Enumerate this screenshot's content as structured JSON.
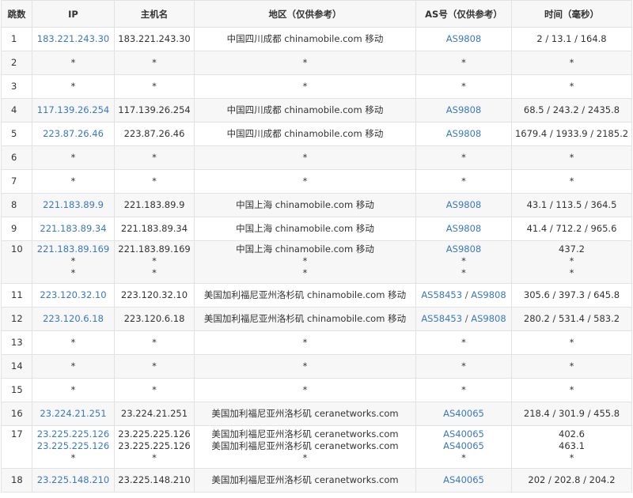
{
  "headers": {
    "hop": "跳数",
    "ip": "IP",
    "host": "主机名",
    "region": "地区（仅供参考）",
    "as": "AS号（仅供参考）",
    "time": "时间（毫秒）"
  },
  "hops": [
    {
      "hop": "1",
      "ips": [
        "183.221.243.30"
      ],
      "hosts": [
        "183.221.243.30"
      ],
      "regions": [
        "中国四川成都 chinamobile.com 移动"
      ],
      "as": [
        [
          "AS9808"
        ]
      ],
      "times": [
        "2 / 13.1 / 164.8"
      ]
    },
    {
      "hop": "2",
      "ips": [
        "*"
      ],
      "hosts": [
        "*"
      ],
      "regions": [
        "*"
      ],
      "as": [
        [
          "*"
        ]
      ],
      "times": [
        "*"
      ]
    },
    {
      "hop": "3",
      "ips": [
        "*"
      ],
      "hosts": [
        "*"
      ],
      "regions": [
        "*"
      ],
      "as": [
        [
          "*"
        ]
      ],
      "times": [
        "*"
      ]
    },
    {
      "hop": "4",
      "ips": [
        "117.139.26.254"
      ],
      "hosts": [
        "117.139.26.254"
      ],
      "regions": [
        "中国四川成都 chinamobile.com 移动"
      ],
      "as": [
        [
          "AS9808"
        ]
      ],
      "times": [
        "68.5 / 243.2 / 2435.8"
      ]
    },
    {
      "hop": "5",
      "ips": [
        "223.87.26.46"
      ],
      "hosts": [
        "223.87.26.46"
      ],
      "regions": [
        "中国四川成都 chinamobile.com 移动"
      ],
      "as": [
        [
          "AS9808"
        ]
      ],
      "times": [
        "1679.4 / 1933.9 / 2185.2"
      ]
    },
    {
      "hop": "6",
      "ips": [
        "*"
      ],
      "hosts": [
        "*"
      ],
      "regions": [
        "*"
      ],
      "as": [
        [
          "*"
        ]
      ],
      "times": [
        "*"
      ]
    },
    {
      "hop": "7",
      "ips": [
        "*"
      ],
      "hosts": [
        "*"
      ],
      "regions": [
        "*"
      ],
      "as": [
        [
          "*"
        ]
      ],
      "times": [
        "*"
      ]
    },
    {
      "hop": "8",
      "ips": [
        "221.183.89.9"
      ],
      "hosts": [
        "221.183.89.9"
      ],
      "regions": [
        "中国上海 chinamobile.com 移动"
      ],
      "as": [
        [
          "AS9808"
        ]
      ],
      "times": [
        "43.1 / 113.5 / 364.5"
      ]
    },
    {
      "hop": "9",
      "ips": [
        "221.183.89.34"
      ],
      "hosts": [
        "221.183.89.34"
      ],
      "regions": [
        "中国上海 chinamobile.com 移动"
      ],
      "as": [
        [
          "AS9808"
        ]
      ],
      "times": [
        "41.4 / 712.2 / 965.6"
      ]
    },
    {
      "hop": "10",
      "ips": [
        "221.183.89.169",
        "*",
        "*"
      ],
      "hosts": [
        "221.183.89.169",
        "*",
        "*"
      ],
      "regions": [
        "中国上海 chinamobile.com 移动",
        "*",
        "*"
      ],
      "as": [
        [
          "AS9808"
        ],
        [
          "*"
        ],
        [
          "*"
        ]
      ],
      "times": [
        "437.2",
        "*",
        "*"
      ]
    },
    {
      "hop": "11",
      "ips": [
        "223.120.32.10"
      ],
      "hosts": [
        "223.120.32.10"
      ],
      "regions": [
        "美国加利福尼亚州洛杉矶 chinamobile.com 移动"
      ],
      "as": [
        [
          "AS58453",
          "AS9808"
        ]
      ],
      "times": [
        "305.6 / 397.3 / 645.8"
      ]
    },
    {
      "hop": "12",
      "ips": [
        "223.120.6.18"
      ],
      "hosts": [
        "223.120.6.18"
      ],
      "regions": [
        "美国加利福尼亚州洛杉矶 chinamobile.com 移动"
      ],
      "as": [
        [
          "AS58453",
          "AS9808"
        ]
      ],
      "times": [
        "280.2 / 531.4 / 583.2"
      ]
    },
    {
      "hop": "13",
      "ips": [
        "*"
      ],
      "hosts": [
        "*"
      ],
      "regions": [
        "*"
      ],
      "as": [
        [
          "*"
        ]
      ],
      "times": [
        "*"
      ]
    },
    {
      "hop": "14",
      "ips": [
        "*"
      ],
      "hosts": [
        "*"
      ],
      "regions": [
        "*"
      ],
      "as": [
        [
          "*"
        ]
      ],
      "times": [
        "*"
      ]
    },
    {
      "hop": "15",
      "ips": [
        "*"
      ],
      "hosts": [
        "*"
      ],
      "regions": [
        "*"
      ],
      "as": [
        [
          "*"
        ]
      ],
      "times": [
        "*"
      ]
    },
    {
      "hop": "16",
      "ips": [
        "23.224.21.251"
      ],
      "hosts": [
        "23.224.21.251"
      ],
      "regions": [
        "美国加利福尼亚州洛杉矶 ceranetworks.com"
      ],
      "as": [
        [
          "AS40065"
        ]
      ],
      "times": [
        "218.4 / 301.9 / 455.8"
      ]
    },
    {
      "hop": "17",
      "ips": [
        "23.225.225.126",
        "23.225.225.126",
        "*"
      ],
      "hosts": [
        "23.225.225.126",
        "23.225.225.126",
        "*"
      ],
      "regions": [
        "美国加利福尼亚州洛杉矶 ceranetworks.com",
        "美国加利福尼亚州洛杉矶 ceranetworks.com",
        "*"
      ],
      "as": [
        [
          "AS40065"
        ],
        [
          "AS40065"
        ],
        [
          "*"
        ]
      ],
      "times": [
        "402.6",
        "463.1",
        "*"
      ]
    },
    {
      "hop": "18",
      "ips": [
        "23.225.148.210"
      ],
      "hosts": [
        "23.225.148.210"
      ],
      "regions": [
        "美国加利福尼亚州洛杉矶 ceranetworks.com"
      ],
      "as": [
        [
          "AS40065"
        ]
      ],
      "times": [
        "202 / 202.8 / 204.2"
      ]
    }
  ],
  "colors": {
    "link": "#3a78c0",
    "header_bg": "#f7f7f7",
    "row_alt_bg": "#f7f7f7",
    "border": "#e2e2e2",
    "text": "#333333"
  }
}
